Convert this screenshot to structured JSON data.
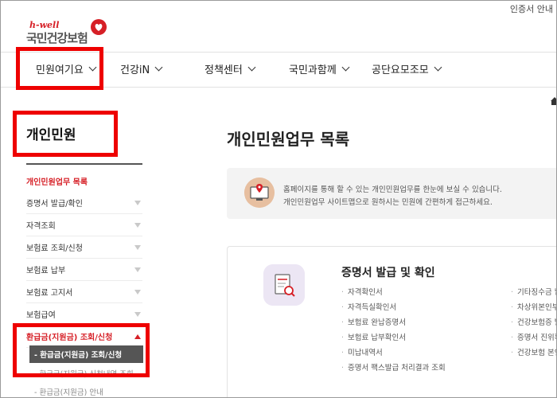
{
  "utility": {
    "cert_guide": "인증서 안내"
  },
  "logo": {
    "tagline": "h-well",
    "brand": "국민건강보험"
  },
  "gnb": [
    {
      "label": "민원여기요"
    },
    {
      "label": "건강iN"
    },
    {
      "label": "정책센터"
    },
    {
      "label": "국민과함께"
    },
    {
      "label": "공단요모조모"
    }
  ],
  "sidebar": {
    "title": "개인민원",
    "items": [
      {
        "label": "개인민원업무 목록"
      },
      {
        "label": "증명서 발급/확인"
      },
      {
        "label": "자격조회"
      },
      {
        "label": "보험료 조회/신청"
      },
      {
        "label": "보험료 납부"
      },
      {
        "label": "보험료 고지서"
      },
      {
        "label": "보험급여"
      },
      {
        "label": "환급금(지원금) 조회/신청"
      }
    ],
    "sub_items": [
      {
        "label": "- 환급금(지원금) 조회/신청"
      },
      {
        "label": "- 환급금(지원금) 신청내역 조회"
      },
      {
        "label": "- 환급금(지원금) 안내"
      }
    ]
  },
  "main": {
    "title": "개인민원업무 목록",
    "info_lines": [
      "홈페이지를 통해 할 수 있는 개인민원업무를 한눈에 보실 수 있습니다.",
      "개인민원업무 사이트맵으로 원하시는 민원에 간편하게 접근하세요."
    ],
    "card": {
      "title": "증명서 발급 및 확인",
      "col1": [
        "자격확인서",
        "자격득실확인서",
        "보험료 완납증명서",
        "보험료 납부확인서",
        "미납내역서",
        "증명서 팩스발급 처리결과 조회"
      ],
      "col2": [
        "기타징수금 납",
        "차상위본인부",
        "건강보험증 발",
        "증명서 진위확",
        "건강보험 본인"
      ]
    }
  },
  "colors": {
    "accent": "#d61f26",
    "highlight": "#ee0000"
  }
}
